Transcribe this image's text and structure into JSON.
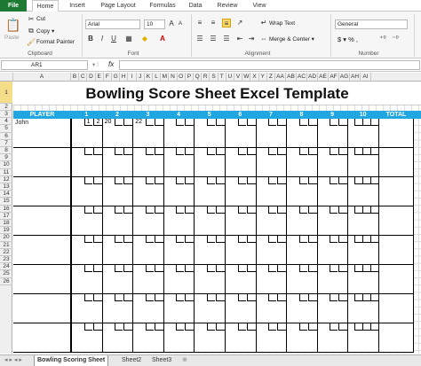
{
  "ribbon_tabs": [
    "File",
    "Home",
    "Insert",
    "Page Layout",
    "Formulas",
    "Data",
    "Review",
    "View"
  ],
  "clipboard": {
    "paste": "Paste",
    "cut": "Cut",
    "copy": "Copy ▾",
    "format_painter": "Format Painter",
    "label": "Clipboard"
  },
  "font": {
    "name": "Arial",
    "size": "10",
    "label": "Font"
  },
  "alignment": {
    "wrap_text": "Wrap Text",
    "merge_center": "Merge & Center ▾",
    "label": "Alignment"
  },
  "number": {
    "format": "General",
    "symbols": "$ ▾ % ,",
    "label": "Number"
  },
  "formula_bar": {
    "name_box": "AR1",
    "fx": "fx"
  },
  "columns": [
    "A",
    "B",
    "C",
    "D",
    "E",
    "F",
    "G",
    "H",
    "I",
    "J",
    "K",
    "L",
    "M",
    "N",
    "O",
    "P",
    "Q",
    "R",
    "S",
    "T",
    "U",
    "V",
    "W",
    "X",
    "Y",
    "Z",
    "AA",
    "AB",
    "AC",
    "AD",
    "AE",
    "AF",
    "AG",
    "AH",
    "AI"
  ],
  "rows": [
    "1",
    "2",
    "3",
    "4",
    "5",
    "6",
    "7",
    "8",
    "9",
    "10",
    "11",
    "12",
    "13",
    "14",
    "15",
    "16",
    "17",
    "18",
    "19",
    "20",
    "21",
    "22",
    "23",
    "24",
    "25",
    "26"
  ],
  "sheet": {
    "title": "Bowling Score Sheet Excel Template",
    "header": {
      "player": "PLAYER",
      "frames": [
        "1",
        "2",
        "3",
        "4",
        "5",
        "6",
        "7",
        "8",
        "9",
        "10"
      ],
      "total": "TOTAL"
    },
    "players": [
      {
        "name": "John",
        "rolls": [
          [
            "1",
            "2"
          ],
          [
            "",
            ""
          ],
          [
            "",
            ""
          ],
          [
            "",
            ""
          ],
          [
            "",
            ""
          ],
          [
            "",
            ""
          ],
          [
            "",
            ""
          ],
          [
            "",
            ""
          ],
          [
            "",
            ""
          ],
          [
            "",
            "",
            ""
          ]
        ],
        "scores": [
          "",
          "20",
          "22",
          "",
          "",
          "",
          "",
          "",
          "",
          ""
        ]
      }
    ]
  },
  "sheet_tabs": [
    "Bowling Scoring Sheet",
    "Sheet2",
    "Sheet3"
  ],
  "colors": {
    "header_fill": "#20a6e0",
    "file_tab": "#1e7a33"
  }
}
